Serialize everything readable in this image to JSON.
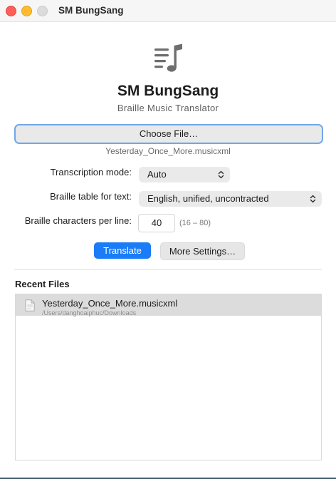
{
  "window": {
    "title": "SM BungSang"
  },
  "header": {
    "app_icon": "music-note-list-icon",
    "app_name": "SM BungSang",
    "subtitle": "Braille Music Translator"
  },
  "file": {
    "choose_label": "Choose File…",
    "selected_name": "Yesterday_Once_More.musicxml"
  },
  "settings": {
    "transcription_mode": {
      "label": "Transcription mode:",
      "value": "Auto"
    },
    "braille_table": {
      "label": "Braille table for text:",
      "value": "English, unified, uncontracted"
    },
    "chars_per_line": {
      "label": "Braille characters per line:",
      "value": "40",
      "range_hint": "(16 – 80)"
    }
  },
  "actions": {
    "translate_label": "Translate",
    "more_settings_label": "More Settings…"
  },
  "recent": {
    "heading": "Recent Files",
    "items": [
      {
        "name": "Yesterday_Once_More.musicxml",
        "path": "/Users/danghoaiphuc/Downloads",
        "icon": "document-icon"
      }
    ]
  },
  "colors": {
    "accent": "#1a7cf7",
    "focus_ring": "#6fa8e6",
    "traffic_red": "#ff5f57",
    "traffic_yellow": "#febc2e"
  }
}
